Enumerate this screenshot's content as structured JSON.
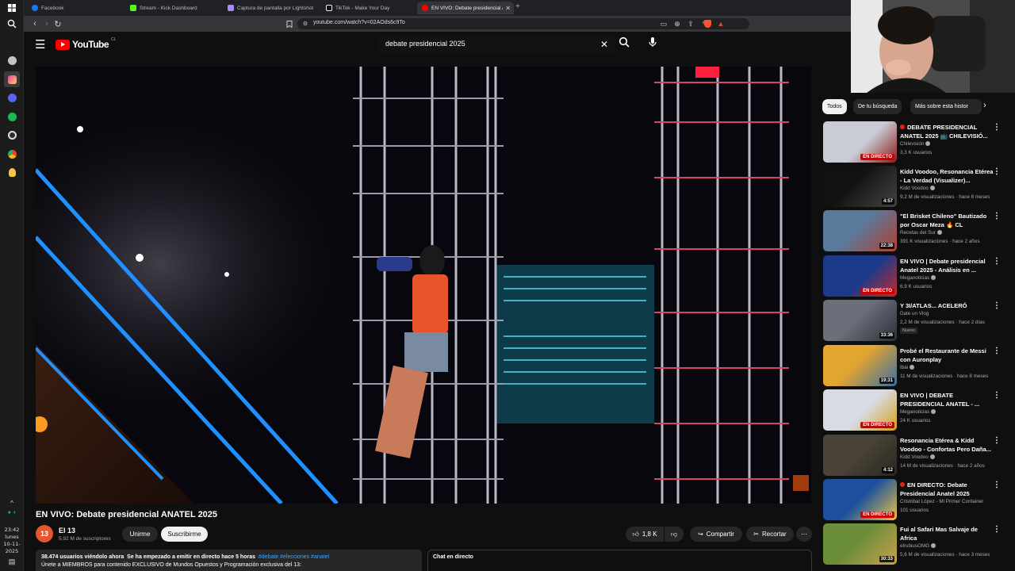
{
  "browser": {
    "tabs": [
      {
        "label": "Facebook",
        "icon": "facebook-icon",
        "color": "#1877f2"
      },
      {
        "label": "Stream - Kick Dashboard",
        "icon": "kick-icon",
        "color": "#53fc18"
      },
      {
        "label": "Captura de pantalla por Lightshot",
        "icon": "lightshot-icon",
        "color": "#a78bfa"
      },
      {
        "label": "TikTok - Make Your Day",
        "icon": "tiktok-icon",
        "color": "#ffffff"
      },
      {
        "label": "EN VIVO: Debate presidencial AN",
        "icon": "youtube-icon",
        "color": "#ff0000"
      }
    ],
    "url": "youtube.com/watch?v=02AOds6c9To"
  },
  "taskbar": {
    "time": "23:42",
    "day": "lunes",
    "date": "10-11-2025",
    "apps": [
      "windows-icon",
      "search-icon",
      "shield-icon",
      "multicolor-app-icon",
      "discord-icon",
      "spotify-icon",
      "obs-icon",
      "chrome-icon",
      "lightbulb-icon"
    ]
  },
  "youtube": {
    "logo_text": "YouTube",
    "country": "CL",
    "search_query": "debate presidencial 2025",
    "video_title": "EN VIVO: Debate presidencial ANATEL 2025",
    "channel": {
      "name": "El 13",
      "subs": "5,92 M de suscriptores",
      "avatar_text": "13"
    },
    "join_label": "Unirme",
    "subscribe_label": "Suscribirme",
    "likes": "1,8 K",
    "share_label": "Compartir",
    "clip_label": "Recortar",
    "description": {
      "viewers": "38.474 usuarios viéndolo ahora",
      "started": "Se ha empezado a emitir en directo hace 5 horas",
      "tags": "#debate #elecciones #anatel",
      "line2": "Únete a MIEMBROS para contenido EXCLUSIVO de Mundos Opuestos y Programación exclusiva del 13:"
    },
    "chat_label": "Chat en directo"
  },
  "chips": [
    "Todos",
    "De tu búsqueda",
    "Más sobre esta histor"
  ],
  "recommendations": [
    {
      "title": "DEBATE PRESIDENCIAL ANATEL 2025 📺 CHILEVISIÓ...",
      "channel": "Chilevisión",
      "meta": "3,3 K usuarios",
      "badge": "EN DIRECTO",
      "live": true,
      "colors": [
        "#c9ccd4",
        "#8a1a1a"
      ]
    },
    {
      "title": "Kidd Voodoo, Resonancia Etérea - La Verdad (Visualizer)...",
      "channel": "Kidd Voodoo",
      "meta": "9,2 M de visualizaciones · hace 8 meses",
      "badge": "4:57",
      "live": false,
      "colors": [
        "#111111",
        "#444444"
      ]
    },
    {
      "title": "\"El Brisket Chileno\" Bautizado por Oscar Meza 🔥 CL",
      "channel": "Recetas del Sur",
      "meta": "391 K visualizaciones · hace 2 años",
      "badge": "22:38",
      "live": false,
      "colors": [
        "#5a7a9c",
        "#b04030"
      ]
    },
    {
      "title": "EN VIVO | Debate presidencial Anatel 2025 - Análisis en ...",
      "channel": "Meganoticias",
      "meta": "6,9 K usuarios",
      "badge": "EN DIRECTO",
      "live": true,
      "colors": [
        "#1b3b8a",
        "#c62828"
      ]
    },
    {
      "title": "Y 3I/ATLAS... ACELERÓ",
      "channel": "Date un Vlog",
      "meta": "2,2 M de visualizaciones · hace 2 días",
      "badge": "33:36",
      "live": false,
      "new": "Nuevo",
      "colors": [
        "#6b6f7a",
        "#2b2f38"
      ]
    },
    {
      "title": "Probé el Restaurante de Messi con Auronplay",
      "channel": "Ibai",
      "meta": "11 M de visualizaciones · hace 8 meses",
      "badge": "19:31",
      "live": false,
      "colors": [
        "#e2a530",
        "#3a6ea5"
      ]
    },
    {
      "title": "EN VIVO | DEBATE PRESIDENCIAL ANATEL - ...",
      "channel": "Meganoticias",
      "meta": "24 K usuarios",
      "badge": "EN DIRECTO",
      "live": true,
      "colors": [
        "#d8dbe4",
        "#d4a017"
      ]
    },
    {
      "title": "Resonancia Etérea & Kidd Voodoo - Confortas Pero Daña...",
      "channel": "Kidd Voodoo",
      "meta": "14 M de visualizaciones · hace 2 años",
      "badge": "4:12",
      "live": false,
      "colors": [
        "#4a4438",
        "#2a2620"
      ]
    },
    {
      "title": "EN DIRECTO: Debate Presidencial Anatel 2025",
      "channel": "Cristóbal López - Mi Primer Container",
      "meta": "101 usuarios",
      "badge": "EN DIRECTO",
      "live": true,
      "colors": [
        "#1e4f9c",
        "#e8c547"
      ]
    },
    {
      "title": "Fui al Safari Mas Salvaje de Africa",
      "channel": "elrubiusOMG",
      "meta": "5,6 M de visualizaciones · hace 3 meses",
      "badge": "30:33",
      "live": false,
      "colors": [
        "#6b8e3a",
        "#c9a04a"
      ]
    }
  ]
}
